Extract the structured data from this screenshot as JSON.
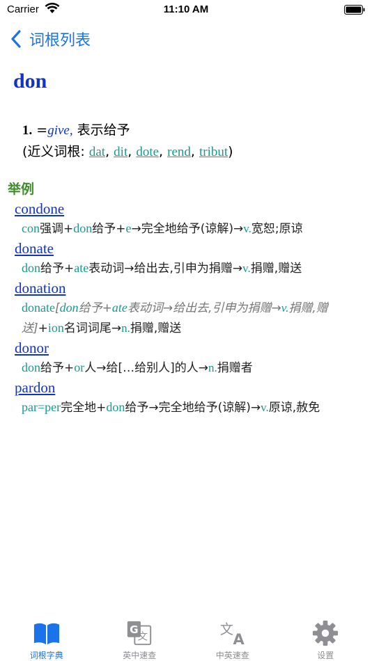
{
  "status": {
    "carrier": "Carrier",
    "time": "11:10 AM"
  },
  "nav": {
    "back_label": "词根列表"
  },
  "entry": {
    "title": "don",
    "meaning": {
      "number": "1.",
      "prefix": "=",
      "give": "give,",
      "text": " 表示给予",
      "syn_prefix": "(近义词根: ",
      "syn_suffix": ")",
      "synonyms": [
        "dat",
        "dit",
        "dote",
        "rend",
        "tribut"
      ]
    }
  },
  "examples_label": "举例",
  "examples": [
    {
      "word": "condone",
      "d1": "con",
      "d2": "强调+",
      "d3": "don",
      "d4": "给予+",
      "d5": "e",
      "d6": "→完全地给予(谅解)→",
      "d7": "v.",
      "d8": "宽恕;原谅"
    },
    {
      "word": "donate",
      "d1": "don",
      "d2": "给予+",
      "d3": "ate",
      "d4": "表动词→给出去,引申为捐赠→",
      "d5": "v.",
      "d6": "捐赠,赠送"
    },
    {
      "word": "donation",
      "d1": "donate",
      "d2": "[",
      "d3": "don",
      "d4": "给予+",
      "d5": "ate",
      "d6": "表动词→给出去,引申为捐赠→",
      "d7": "v.",
      "d8": "捐赠,赠送]",
      "d9": "+",
      "d10": "ion",
      "d11": "名词词尾→",
      "d12": "n.",
      "d13": "捐赠,赠送"
    },
    {
      "word": "donor",
      "d1": "don",
      "d2": "给予+",
      "d3": "or",
      "d4": "人→给[…给别人]的人→",
      "d5": "n.",
      "d6": "捐赠者"
    },
    {
      "word": "pardon",
      "d1": "par",
      "d2": "=",
      "d3": "per",
      "d4": "完全地+",
      "d5": "don",
      "d6": "给予→完全地给予(谅解)→",
      "d7": "v.",
      "d8": "原谅,赦免"
    }
  ],
  "tabs": [
    {
      "label": "词根字典",
      "icon": "book-icon"
    },
    {
      "label": "英中速查",
      "icon": "translate-g-icon"
    },
    {
      "label": "中英速查",
      "icon": "translate-a-icon"
    },
    {
      "label": "设置",
      "icon": "gear-icon"
    }
  ],
  "colors": {
    "accent": "#1a73e8",
    "root": "#1a9a8e",
    "link": "#1133cc",
    "section": "#3f8c2a"
  }
}
